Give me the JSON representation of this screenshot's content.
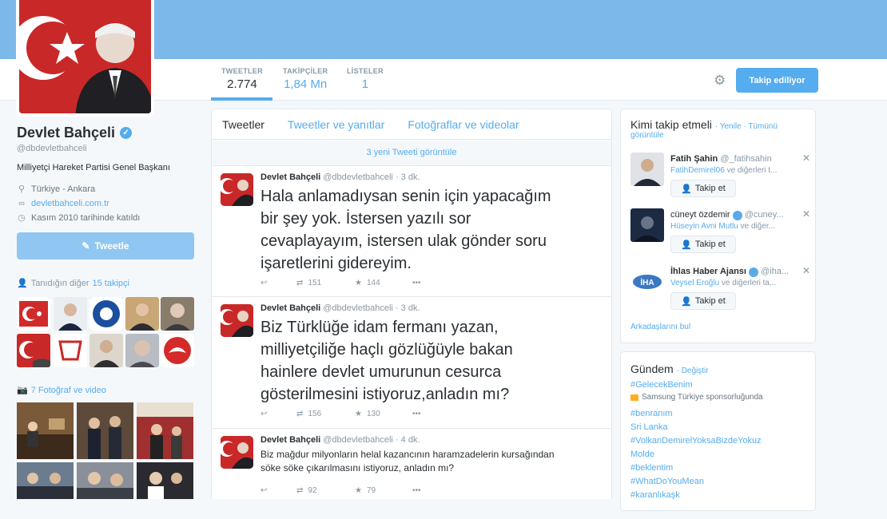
{
  "profile": {
    "name": "Devlet Bahçeli",
    "handle": "@dbdevletbahceli",
    "bio": "Milliyetçi Hareket Partisi Genel Başkanı",
    "location": "Türkiye - Ankara",
    "website": "devletbahceli.com.tr",
    "joined": "Kasım 2010 tarihinde katıldı",
    "tweet_button": "Tweetle"
  },
  "stats": [
    {
      "label": "TWEETLER",
      "value": "2.774"
    },
    {
      "label": "TAKİPÇİLER",
      "value": "1,84 Mn"
    },
    {
      "label": "LİSTELER",
      "value": "1"
    }
  ],
  "header": {
    "follow_button": "Takip ediliyor"
  },
  "followers_you_know": {
    "prefix": "Tanıdığın diğer",
    "link": "15 takipçi"
  },
  "photos": {
    "label": "7 Fotoğraf ve video"
  },
  "timeline": {
    "tabs": [
      "Tweetler",
      "Tweetler ve yanıtlar",
      "Fotoğraflar ve videolar"
    ],
    "new_tweets": "3 yeni Tweeti görüntüle",
    "tweets": [
      {
        "name": "Devlet Bahçeli",
        "handle": "@dbdevletbahceli",
        "time": "· 3 dk.",
        "lines": [
          "Hala anlamadıysan senin için yapacağım",
          "bir şey yok. İstersen yazılı sor",
          "cevaplayayım, istersen ulak gönder soru",
          "işaretlerini gidereyim."
        ],
        "retweets": "151",
        "favorites": "144"
      },
      {
        "name": "Devlet Bahçeli",
        "handle": "@dbdevletbahceli",
        "time": "· 3 dk.",
        "lines": [
          "Biz Türklüğe idam fermanı yazan,",
          "milliyetçiliğe haçlı gözlüğüyle bakan",
          "hainlere devlet umurunun cesurca",
          "gösterilmesini istiyoruz,anladın mı?"
        ],
        "retweets": "156",
        "favorites": "130"
      },
      {
        "name": "Devlet Bahçeli",
        "handle": "@dbdevletbahceli",
        "time": "· 4 dk.",
        "lines": [
          "Biz mağdur milyonların helal kazancının haramzadelerin kursağından",
          "söke söke çıkarılmasını istiyoruz, anladın mı?"
        ],
        "retweets": "92",
        "favorites": "79"
      }
    ]
  },
  "who_to_follow": {
    "title": "Kimi takip etmeli",
    "refresh": "· Yenile · Tümünü",
    "view_all": "görüntüle",
    "follow_label": "Takip et",
    "find_friends": "Arkadaşlarını bul",
    "users": [
      {
        "name": "Fatih Şahin",
        "handle": "@_fatihsahin",
        "sub_link": "FatihDemirel06",
        "sub_rest": " ve diğerleri t..."
      },
      {
        "name": "cüneyt özdemir",
        "handle": "@cuney...",
        "sub_link": "Hüseyin Avni Mutlu",
        "sub_rest": " ve diğer..."
      },
      {
        "name": "İhlas Haber Ajansı",
        "handle": "@iha...",
        "sub_link": "Veysel Eroğlu",
        "sub_rest": " ve diğerleri ta..."
      }
    ]
  },
  "trends": {
    "title": "Gündem",
    "change": "· Değiştir",
    "promoted_name": "#GelecekBenim",
    "promoted_by": "Samsung Türkiye sponsorluğunda",
    "items": [
      "#benranım",
      "Sri Lanka",
      "#VolkanDemirelYoksaBizdeYokuz",
      "Molde",
      "#beklentim",
      "#WhatDoYouMean",
      "#karanlıkaşk"
    ]
  },
  "colors": {
    "accent": "#55acee",
    "banner": "#7db8ea",
    "flag_red": "#c92828"
  }
}
